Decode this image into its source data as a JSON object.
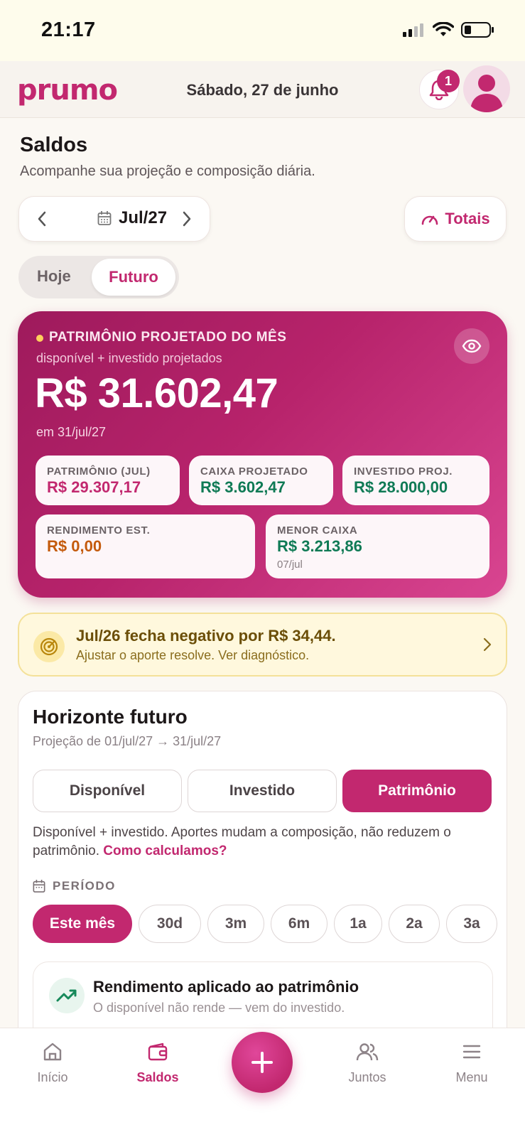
{
  "status_bar": {
    "time": "21:17"
  },
  "header": {
    "logo": "prumo",
    "date": "Sábado, 27 de junho",
    "notification_count": "1"
  },
  "page": {
    "title": "Saldos",
    "subtitle": "Acompanhe sua projeção e composição diária."
  },
  "month_selector": {
    "label": "Jul/27"
  },
  "totais_label": "Totais",
  "segment": {
    "options": [
      "Hoje",
      "Futuro"
    ],
    "selected": "Futuro"
  },
  "hero": {
    "kicker": "PATRIMÔNIO PROJETADO DO MÊS",
    "subtitle": "disponível + investido projetados",
    "value": "R$ 31.602,47",
    "date": "em 31/jul/27",
    "stats": [
      {
        "label": "PATRIMÔNIO (JUL)",
        "value": "R$ 29.307,17",
        "color": "#c2286f"
      },
      {
        "label": "CAIXA PROJETADO",
        "value": "R$ 3.602,47",
        "color": "#0f7a55"
      },
      {
        "label": "INVESTIDO PROJ.",
        "value": "R$ 28.000,00",
        "color": "#0f7a55"
      },
      {
        "label": "RENDIMENTO EST.",
        "value": "R$ 0,00",
        "color": "#c45a0c"
      },
      {
        "label": "MENOR CAIXA",
        "value": "R$ 3.213,86",
        "note": "07/jul",
        "color": "#0f7a55"
      }
    ]
  },
  "alert": {
    "title": "Jul/26 fecha negativo por R$ 34,44.",
    "subtitle": "Ajustar o aporte resolve. Ver diagnóstico."
  },
  "horizon": {
    "title": "Horizonte futuro",
    "subtitle": "Projeção de 01/jul/27 → 31/jul/27",
    "tabs": [
      "Disponível",
      "Investido",
      "Patrimônio"
    ],
    "active_tab": "Patrimônio",
    "description": "Disponível + investido. Aportes mudam a composição, não reduzem o patrimônio.",
    "link": "Como calculamos?",
    "period_label": "PERÍODO",
    "periods": [
      "Este mês",
      "30d",
      "3m",
      "6m",
      "1a",
      "2a",
      "3a"
    ],
    "active_period": "Este mês",
    "rendimento": {
      "title": "Rendimento aplicado ao patrimônio",
      "subtitle": "O disponível não rende — vem do investido."
    }
  },
  "bottom_nav": {
    "items": [
      "Início",
      "Saldos",
      "Juntos",
      "Menu"
    ],
    "active": "Saldos"
  },
  "colors": {
    "brand": "#c2286f",
    "positive": "#0f7a55",
    "warning": "#c45a0c"
  }
}
